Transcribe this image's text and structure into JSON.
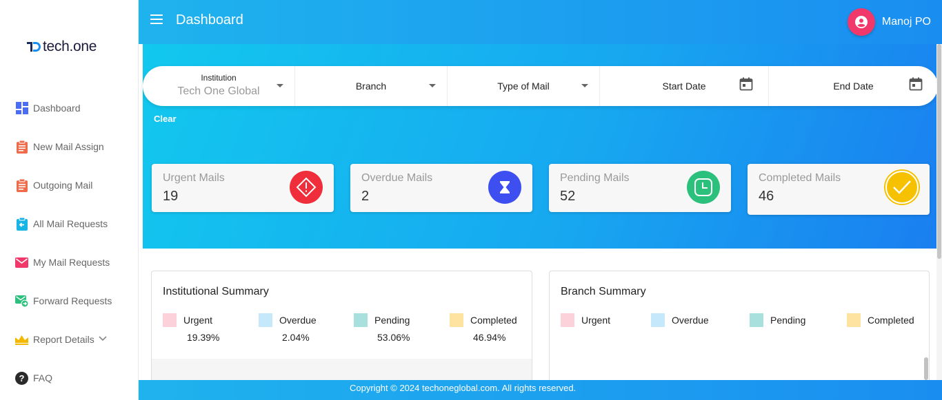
{
  "brand": {
    "name": "tech.one",
    "colors": {
      "primary": "#1a8ef0",
      "accent": "#12c8ee"
    }
  },
  "sidebar": {
    "items": [
      {
        "label": "Dashboard",
        "icon": "dashboard-grid-icon",
        "color": "#4a6cf7"
      },
      {
        "label": "New Mail Assign",
        "icon": "clipboard-icon",
        "color": "#f06b4a"
      },
      {
        "label": "Outgoing Mail",
        "icon": "clipboard-icon",
        "color": "#f06b4a"
      },
      {
        "label": "All Mail Requests",
        "icon": "clipboard-arrow-icon",
        "color": "#19b4e6"
      },
      {
        "label": "My Mail Requests",
        "icon": "mail-icon",
        "color": "#f0396a"
      },
      {
        "label": "Forward Requests",
        "icon": "mail-forward-icon",
        "color": "#2bc07b"
      },
      {
        "label": "Report Details",
        "icon": "crown-icon",
        "color": "#f5b800"
      },
      {
        "label": "FAQ",
        "icon": "help-icon",
        "color": "#333333"
      }
    ]
  },
  "header": {
    "title": "Dashboard",
    "user": "Manoj PO"
  },
  "filters": {
    "institution_label": "Institution",
    "institution_value": "Tech One Global",
    "branch": "Branch",
    "type_of_mail": "Type of Mail",
    "start_date": "Start Date",
    "end_date": "End Date",
    "clear": "Clear"
  },
  "stats": [
    {
      "label": "Urgent Mails",
      "value": "19",
      "icon": "warning-diamond-icon",
      "color": "#f02d3a"
    },
    {
      "label": "Overdue Mails",
      "value": "2",
      "icon": "hourglass-icon",
      "color": "#3d4ff0"
    },
    {
      "label": "Pending Mails",
      "value": "52",
      "icon": "clock-square-icon",
      "color": "#2bc07b"
    },
    {
      "label": "Completed Mails",
      "value": "46",
      "icon": "check-icon",
      "color": "#f5c100"
    }
  ],
  "institutional_summary": {
    "title": "Institutional Summary",
    "legend": [
      {
        "label": "Urgent",
        "pct": "19.39%",
        "color": "#fdd1d9"
      },
      {
        "label": "Overdue",
        "pct": "2.04%",
        "color": "#c6e8fb"
      },
      {
        "label": "Pending",
        "pct": "53.06%",
        "color": "#a7e0dc"
      },
      {
        "label": "Completed",
        "pct": "46.94%",
        "color": "#fde2a0"
      }
    ]
  },
  "branch_summary": {
    "title": "Branch Summary",
    "legend": [
      {
        "label": "Urgent",
        "color": "#fdd1d9"
      },
      {
        "label": "Overdue",
        "color": "#c6e8fb"
      },
      {
        "label": "Pending",
        "color": "#a7e0dc"
      },
      {
        "label": "Completed",
        "color": "#fde2a0"
      }
    ]
  },
  "footer": {
    "text": "Copyright © 2024 techoneglobal.com. All rights reserved."
  }
}
